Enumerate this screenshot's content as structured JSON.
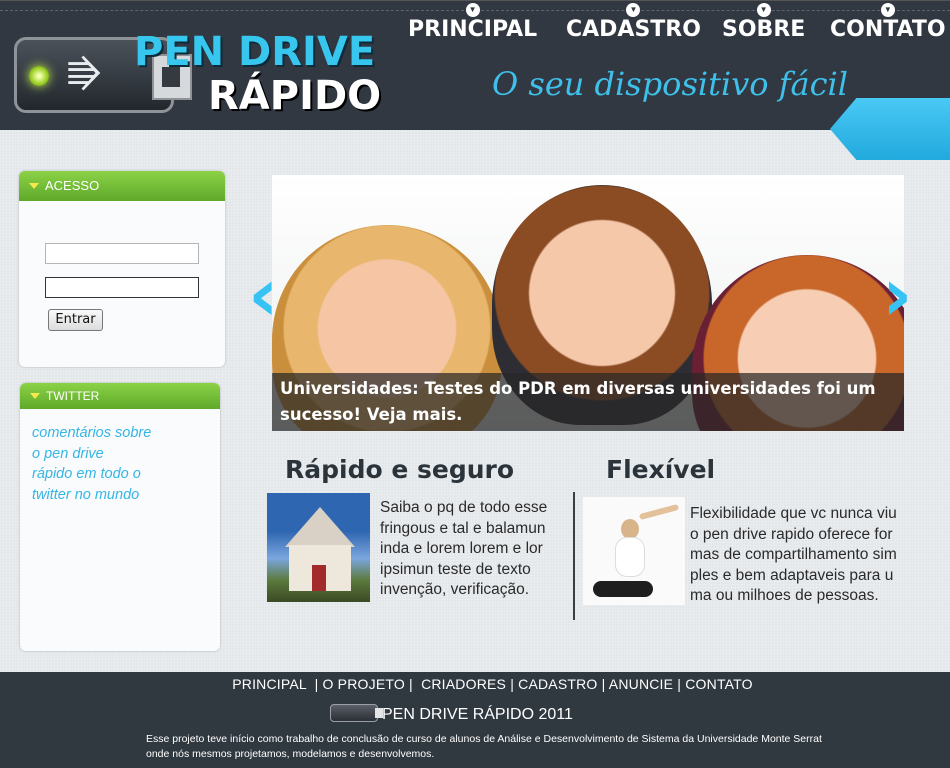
{
  "header": {
    "logo": {
      "line1": "PEN DRIVE",
      "line2": "RÁPIDO"
    },
    "nav": [
      {
        "label": "PRINCIPAL"
      },
      {
        "label": "CADASTRO"
      },
      {
        "label": "SOBRE"
      },
      {
        "label": "CONTATO"
      }
    ],
    "slogan": "O seu dispositivo fácil"
  },
  "sidebar": {
    "acesso": {
      "title": "ACESSO",
      "login_button": "Entrar"
    },
    "twitter": {
      "title": "TWITTER",
      "lines": [
        "comentários sobre",
        "o pen drive",
        "rápido em todo o",
        "twitter no mundo"
      ]
    }
  },
  "slider": {
    "caption": "Universidades: Testes do PDR em diversas universidades foi um sucesso! Veja mais.",
    "prev": "‹",
    "next": "›"
  },
  "features": [
    {
      "title": "Rápido e seguro",
      "icon": "house-lock-image",
      "lines": [
        "Saiba o pq de todo esse",
        "fringous e tal e balamun",
        "inda e lorem lorem e lor",
        "ipsimun teste de texto",
        "invenção, verificação."
      ]
    },
    {
      "title": "Flexível",
      "icon": "yoga-woman-image",
      "lines": [
        "Flexibilidade que vc nunca viu",
        "o pen drive rapido oferece for",
        "mas de compartilhamento sim",
        "ples e bem adaptaveis para u",
        "ma ou milhoes de pessoas."
      ]
    }
  ],
  "footer": {
    "links": [
      "PRINCIPAL",
      "O PROJETO",
      "CRIADORES",
      "CADASTRO",
      "ANUNCIE",
      "CONTATO"
    ],
    "brand": "PEN DRIVE RÁPIDO 2011",
    "about": "Esse projeto teve início como trabalho de conclusão de curso de alunos de Análise e Desenvolvimento de Sistema da Universidade Monte Serrat onde nós mesmos projetamos, modelamos e desenvolvemos."
  },
  "colors": {
    "header_bg": "#313841",
    "accent_blue": "#37c6ee",
    "green": "#6fba33"
  }
}
